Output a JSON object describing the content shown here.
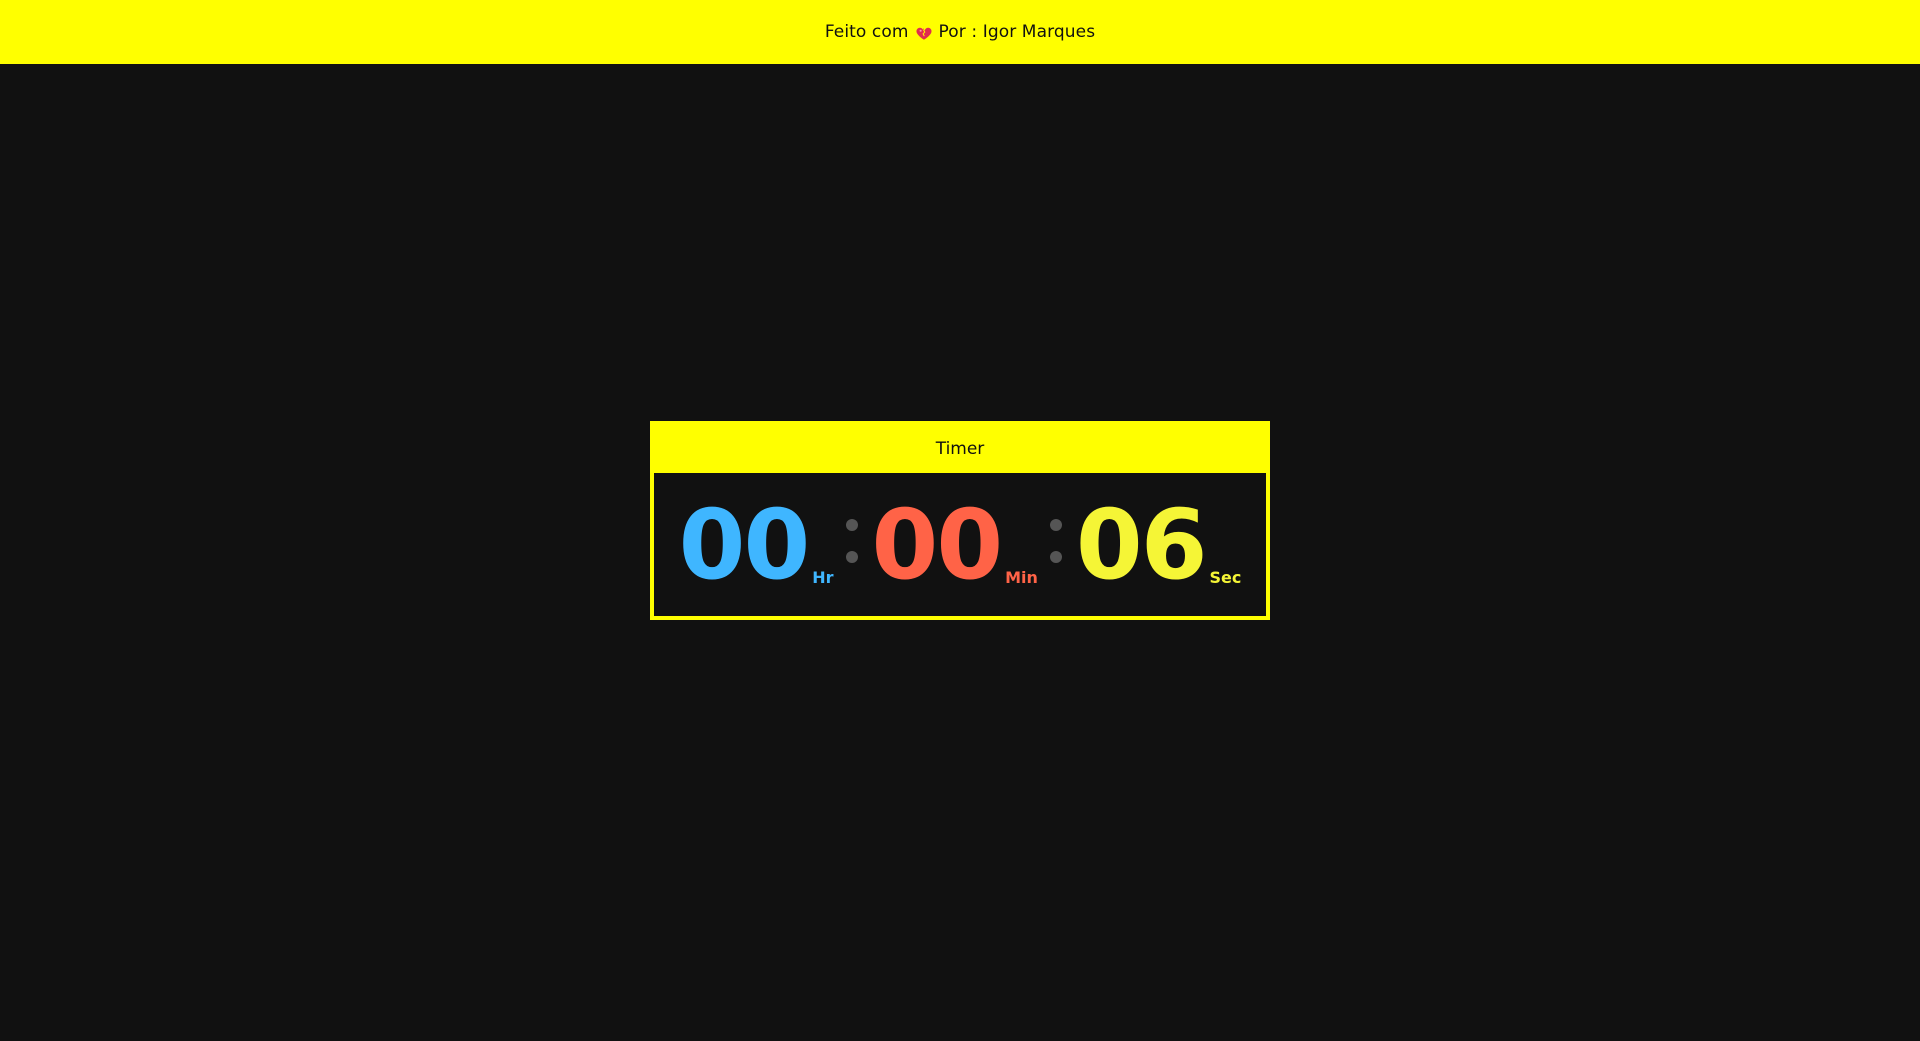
{
  "footer": {
    "made_with": "Feito com",
    "heart_icon": "heart-icon",
    "by": "Por : Igor Marques"
  },
  "timer": {
    "title": "Timer",
    "hours": {
      "value": "00",
      "unit": "Hr",
      "color": "#3fb6ff"
    },
    "minutes": {
      "value": "00",
      "unit": "Min",
      "color": "#ff6347"
    },
    "seconds": {
      "value": "06",
      "unit": "Sec",
      "color": "#f5f536"
    }
  },
  "colors": {
    "accent": "#ffff00",
    "background": "#111111",
    "separator": "#555555"
  }
}
